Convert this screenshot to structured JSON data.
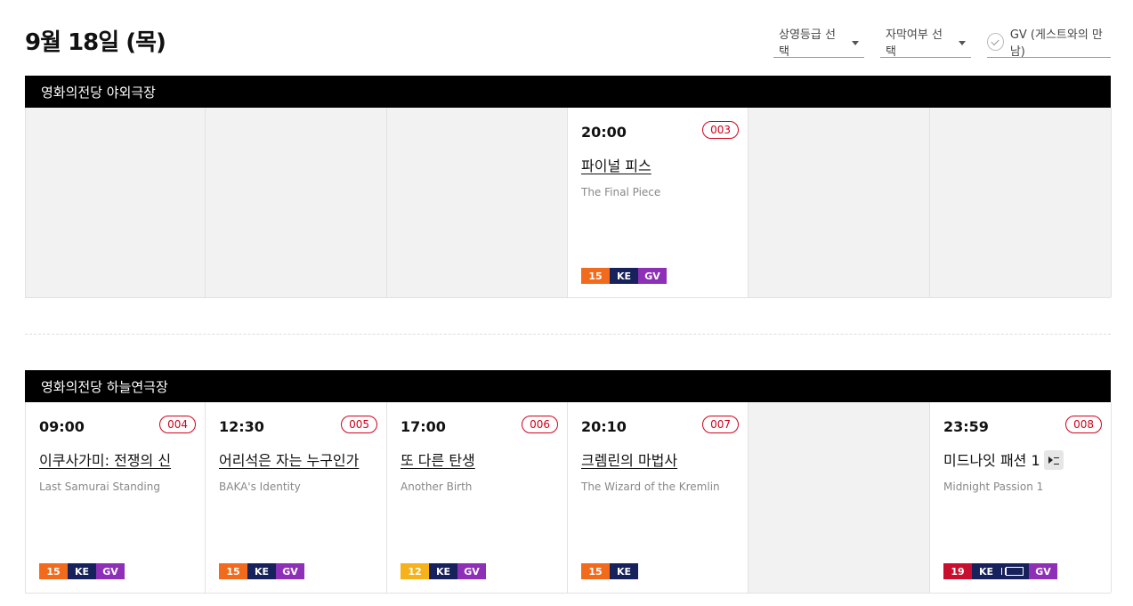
{
  "page": {
    "title": "9월 18일 (목)"
  },
  "filters": {
    "rating": "상영등급 선택",
    "subtitle": "자막여부 선택",
    "gv": "GV (게스트와의 만남)"
  },
  "colors": {
    "rating15": "#f26b1d",
    "rating12": "#f5b21b",
    "rating19": "#c8102e",
    "ke": "#17215b",
    "gv": "#8e2fb8",
    "code": "#d0021b"
  },
  "venues": [
    {
      "name": "영화의전당 야외극장",
      "screenings": [
        {
          "time": "20:00",
          "code": "003",
          "title_ko": "파이널 피스",
          "title_en": "The Final Piece",
          "badges": [
            "15",
            "KE",
            "GV"
          ]
        }
      ]
    },
    {
      "name": "영화의전당 하늘연극장",
      "screenings": [
        {
          "time": "09:00",
          "code": "004",
          "title_ko": "이쿠사가미: 전쟁의 신",
          "title_en": "Last Samurai Standing",
          "badges": [
            "15",
            "KE",
            "GV"
          ]
        },
        {
          "time": "12:30",
          "code": "005",
          "title_ko": "어리석은 자는 누구인가",
          "title_en": "BAKA's Identity",
          "badges": [
            "15",
            "KE",
            "GV"
          ]
        },
        {
          "time": "17:00",
          "code": "006",
          "title_ko": "또 다른 탄생",
          "title_en": "Another Birth",
          "badges": [
            "12",
            "KE",
            "GV"
          ]
        },
        {
          "time": "20:10",
          "code": "007",
          "title_ko": "크렘린의 마법사",
          "title_en": "The Wizard of the Kremlin",
          "badges": [
            "15",
            "KE"
          ]
        },
        {
          "time": "23:59",
          "code": "008",
          "title_ko": "미드나잇 패션 1",
          "title_en": "Midnight Passion 1",
          "badges": [
            "19",
            "KE",
            "GV"
          ],
          "icon": "playlist-icon",
          "extra_icon": "audio-description-film-icon"
        }
      ]
    }
  ]
}
